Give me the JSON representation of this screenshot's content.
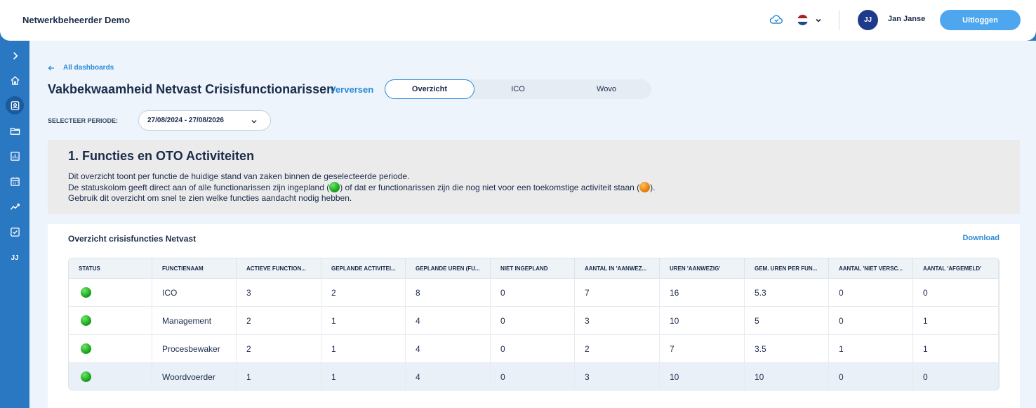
{
  "app": {
    "title": "Netwerkbeheerder Demo"
  },
  "header": {
    "cloud_icon": "cloud-sync-icon",
    "language_flag": "netherlands-flag",
    "user_initials": "JJ",
    "user_name": "Jan Janse",
    "logout_label": "Uitloggen"
  },
  "sidebar": {
    "items": [
      {
        "icon": "chevron-right-icon"
      },
      {
        "icon": "home-icon"
      },
      {
        "icon": "user-badge-icon",
        "active": true
      },
      {
        "icon": "folder-icon"
      },
      {
        "icon": "bar-chart-icon"
      },
      {
        "icon": "calendar-icon"
      },
      {
        "icon": "trend-line-icon"
      },
      {
        "icon": "checklist-icon"
      }
    ],
    "initials": "JJ"
  },
  "page": {
    "back_label": "All dashboards",
    "title": "Vakbekwaamheid Netvast Crisisfunctionarissen",
    "refresh_label": "Verversen",
    "tabs": [
      {
        "label": "Overzicht",
        "active": true
      },
      {
        "label": "ICO",
        "active": false
      },
      {
        "label": "Wovo",
        "active": false
      }
    ],
    "period_label": "SELECTEER PERIODE:",
    "period_value": "27/08/2024 - 27/08/2026"
  },
  "info": {
    "title": "1. Functies en OTO Activiteiten",
    "line1": "Dit overzicht toont per functie de huidige stand van zaken binnen de geselecteerde periode.",
    "line2_a": "De statuskolom geeft direct aan of alle functionarissen zijn ingepland (",
    "line2_b": ") of dat er functionarissen zijn die nog niet voor een toekomstige activiteit staan (",
    "line2_c": ").",
    "line3": "Gebruik dit overzicht om snel te zien welke functies aandacht nodig hebben.",
    "colors": {
      "green": "#1aa51a",
      "orange": "#f08c00"
    }
  },
  "table": {
    "title": "Overzicht crisisfuncties Netvast",
    "download_label": "Download",
    "columns": [
      "STATUS",
      "FUNCTIENAAM",
      "ACTIEVE FUNCTION...",
      "GEPLANDE ACTIVITEI...",
      "GEPLANDE UREN (FU...",
      "NIET INGEPLAND",
      "AANTAL IN 'AANWEZ...",
      "UREN 'AANWEZIG'",
      "GEM. UREN PER FUN...",
      "AANTAL 'NIET VERSC...",
      "AANTAL 'AFGEMELD'"
    ],
    "rows": [
      {
        "status": "green",
        "cells": [
          "ICO",
          "3",
          "2",
          "8",
          "0",
          "7",
          "16",
          "5.3",
          "0",
          "0"
        ]
      },
      {
        "status": "green",
        "cells": [
          "Management",
          "2",
          "1",
          "4",
          "0",
          "3",
          "10",
          "5",
          "0",
          "1"
        ]
      },
      {
        "status": "green",
        "cells": [
          "Procesbewaker",
          "2",
          "1",
          "4",
          "0",
          "2",
          "7",
          "3.5",
          "1",
          "1"
        ]
      },
      {
        "status": "green",
        "cells": [
          "Woordvoerder",
          "1",
          "1",
          "4",
          "0",
          "3",
          "10",
          "10",
          "0",
          "0"
        ]
      }
    ]
  }
}
